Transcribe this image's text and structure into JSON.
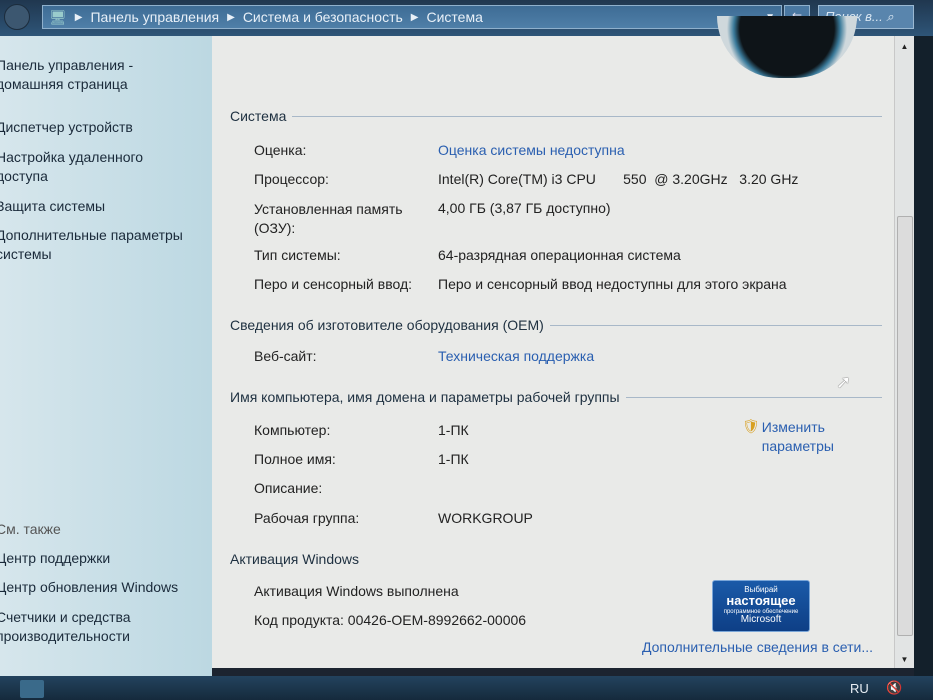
{
  "address_bar": {
    "path": [
      "Панель управления",
      "Система и безопасность",
      "Система"
    ],
    "search_placeholder": "Поиск в..."
  },
  "sidebar": {
    "items": [
      "Панель управления -\nдомашняя страница",
      "Диспетчер устройств",
      "Настройка удаленного\nдоступа",
      "Защита системы",
      "Дополнительные параметры\nсистемы"
    ],
    "see_also": "См. также",
    "see_also_items": [
      "Центр поддержки",
      "Центр обновления Windows",
      "Счетчики и средства\nпроизводительности"
    ]
  },
  "system": {
    "heading": "Система",
    "rows": [
      {
        "label": "Оценка:",
        "value": "Оценка системы недоступна",
        "link": true
      },
      {
        "label": "Процессор:",
        "value": "Intel(R) Core(TM) i3 CPU       550  @ 3.20GHz   3.20 GHz"
      },
      {
        "label": "Установленная память\n(ОЗУ):",
        "value": "4,00 ГБ (3,87 ГБ доступно)"
      },
      {
        "label": "Тип системы:",
        "value": "64-разрядная операционная система"
      },
      {
        "label": "Перо и сенсорный ввод:",
        "value": "Перо и сенсорный ввод недоступны для этого экрана"
      }
    ]
  },
  "oem": {
    "heading": "Сведения об изготовителе оборудования (OEM)",
    "label": "Веб-сайт:",
    "value": "Техническая поддержка"
  },
  "computer": {
    "heading": "Имя компьютера, имя домена и параметры рабочей группы",
    "change_label": "Изменить\nпараметры",
    "rows": [
      {
        "label": "Компьютер:",
        "value": "1-ПК"
      },
      {
        "label": "Полное имя:",
        "value": "1-ПК"
      },
      {
        "label": "Описание:",
        "value": ""
      },
      {
        "label": "Рабочая группа:",
        "value": "WORKGROUP"
      }
    ]
  },
  "activation": {
    "heading": "Активация Windows",
    "status": "Активация Windows выполнена",
    "product_key": "Код продукта: 00426-OEM-8992662-00006",
    "more_link": "Дополнительные сведения в сети...",
    "badge": {
      "line1": "Выбирай",
      "line2": "настоящее",
      "line3": "программное обеспечение",
      "line4": "Microsoft"
    }
  },
  "taskbar": {
    "language": "RU"
  },
  "colors": {
    "link": "#2a5fb0",
    "badge": "#1a5aa8"
  }
}
